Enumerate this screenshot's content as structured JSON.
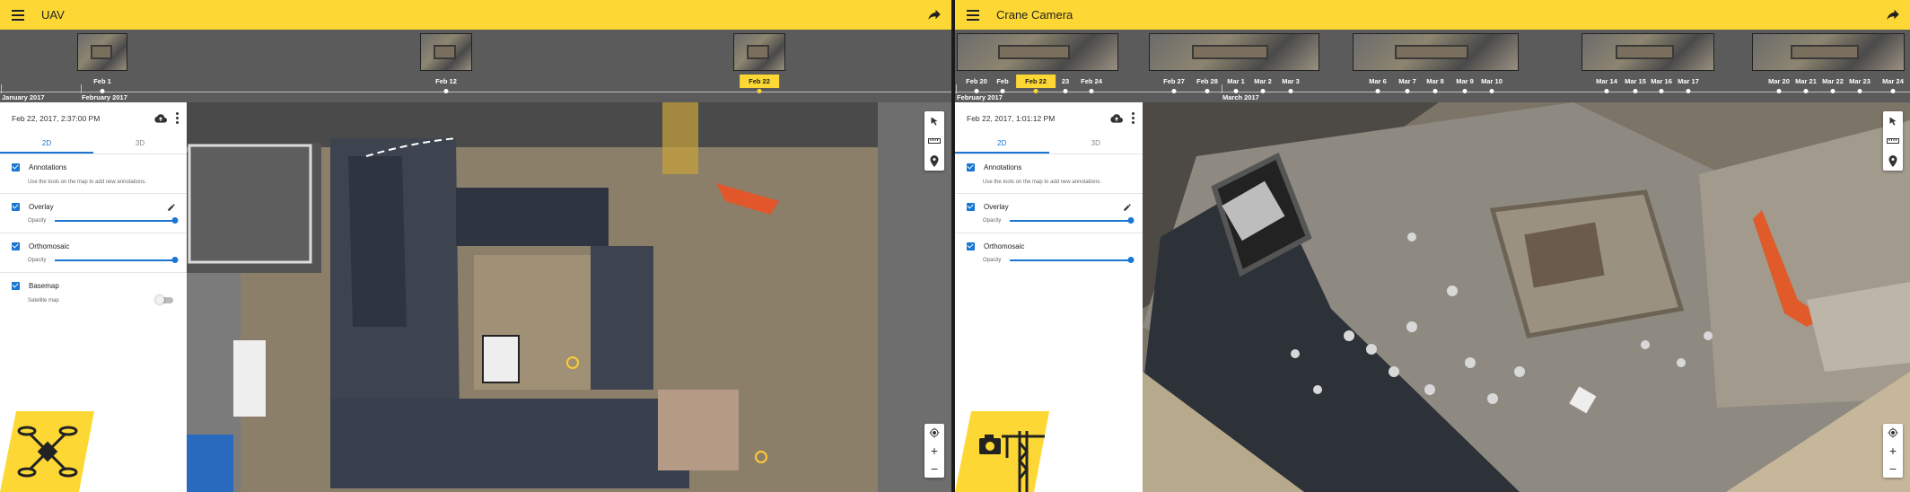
{
  "left": {
    "title": "UAV",
    "timeline": {
      "months": [
        {
          "label": "January 2017"
        },
        {
          "label": "February 2017"
        }
      ],
      "dates": [
        {
          "label": "Feb 1",
          "selected": false
        },
        {
          "label": "Feb 12",
          "selected": false
        },
        {
          "label": "Feb 22",
          "selected": true
        }
      ]
    },
    "panel": {
      "timestamp": "Feb 22, 2017, 2:37:00 PM",
      "tabs": [
        "2D",
        "3D"
      ],
      "active_tab": "2D",
      "layers": {
        "annotations": {
          "name": "Annotations",
          "desc": "Use the tools on the map to add new annotations."
        },
        "overlay": {
          "name": "Overlay",
          "opacity_label": "Opacity",
          "opacity": 1.0
        },
        "orthomosaic": {
          "name": "Orthomosaic",
          "opacity_label": "Opacity",
          "opacity": 1.0
        },
        "basemap": {
          "name": "Basemap",
          "toggle_label": "Satellite map",
          "satellite": false
        }
      }
    }
  },
  "right": {
    "title": "Crane Camera",
    "timeline": {
      "months": [
        {
          "label": "February 2017"
        },
        {
          "label": "March 2017"
        }
      ],
      "dates": [
        {
          "label": "Feb 20",
          "selected": false
        },
        {
          "label": "Feb",
          "selected": false
        },
        {
          "label": "Feb 22",
          "selected": true
        },
        {
          "label": "23",
          "selected": false
        },
        {
          "label": "Feb 24",
          "selected": false
        },
        {
          "label": "Feb 27",
          "selected": false
        },
        {
          "label": "Feb 28",
          "selected": false
        },
        {
          "label": "Mar 1",
          "selected": false
        },
        {
          "label": "Mar 2",
          "selected": false
        },
        {
          "label": "Mar 3",
          "selected": false
        },
        {
          "label": "Mar 6",
          "selected": false
        },
        {
          "label": "Mar 7",
          "selected": false
        },
        {
          "label": "Mar 8",
          "selected": false
        },
        {
          "label": "Mar 9",
          "selected": false
        },
        {
          "label": "Mar 10",
          "selected": false
        },
        {
          "label": "Mar 14",
          "selected": false
        },
        {
          "label": "Mar 15",
          "selected": false
        },
        {
          "label": "Mar 16",
          "selected": false
        },
        {
          "label": "Mar 17",
          "selected": false
        },
        {
          "label": "Mar 20",
          "selected": false
        },
        {
          "label": "Mar 21",
          "selected": false
        },
        {
          "label": "Mar 22",
          "selected": false
        },
        {
          "label": "Mar 23",
          "selected": false
        },
        {
          "label": "Mar 24",
          "selected": false
        }
      ]
    },
    "panel": {
      "timestamp": "Feb 22, 2017, 1:01:12 PM",
      "tabs": [
        "2D",
        "3D"
      ],
      "active_tab": "2D",
      "layers": {
        "annotations": {
          "name": "Annotations",
          "desc": "Use the tools on the map to add new annotations."
        },
        "overlay": {
          "name": "Overlay",
          "opacity_label": "Opacity",
          "opacity": 1.0
        },
        "orthomosaic": {
          "name": "Orthomosaic",
          "opacity_label": "Opacity",
          "opacity": 1.0
        }
      }
    }
  },
  "colors": {
    "accent": "#fdd835",
    "primary": "#1976d2",
    "timeline_bg": "#5b5b5b",
    "panel_bg": "#ffffff"
  },
  "icons": [
    "menu-icon",
    "share-icon",
    "cloud-upload-icon",
    "more-vert-icon",
    "pencil-icon",
    "pointer-icon",
    "ruler-icon",
    "location-pin-icon",
    "locate-icon",
    "zoom-in-icon",
    "zoom-out-icon",
    "drone-icon",
    "crane-camera-icon"
  ]
}
